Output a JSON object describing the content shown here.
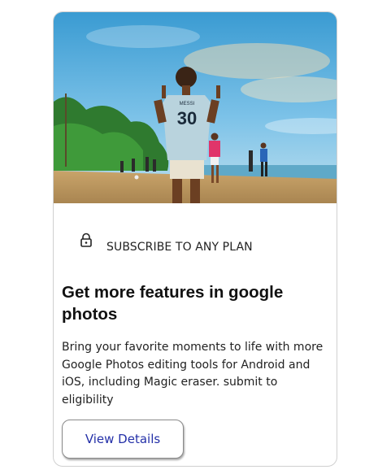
{
  "card": {
    "image_alt": "Man in a jersey number 30 posing on a beach with people playing football",
    "jersey": {
      "name": "MESSI",
      "number": "30"
    },
    "badge": {
      "icon": "lock-icon",
      "text": "SUBSCRIBE TO ANY PLAN"
    },
    "title": "Get more features in google photos",
    "description": "Bring your favorite moments to life with more Google Photos editing tools for Android and iOS, including Magic eraser. submit to eligibility",
    "button_label": "View Details"
  },
  "colors": {
    "button_text": "#2430a8",
    "button_border": "#8a8a8a",
    "card_border": "#d0d0d0"
  }
}
